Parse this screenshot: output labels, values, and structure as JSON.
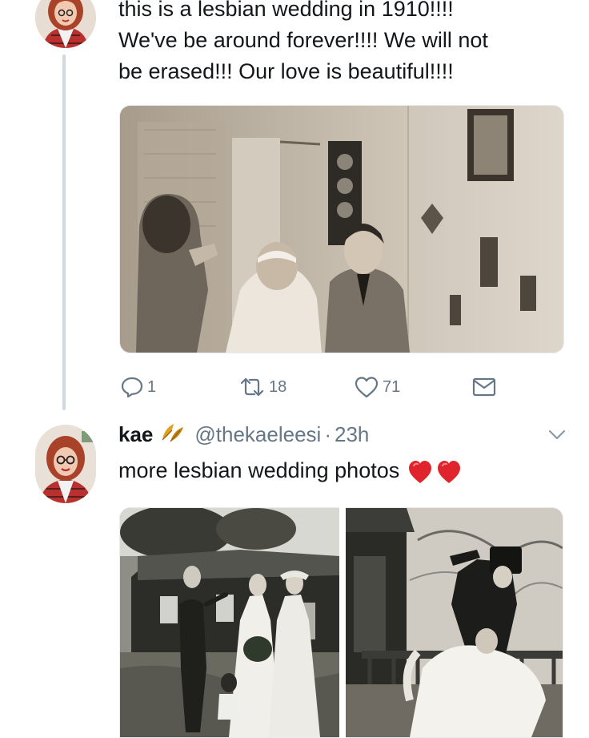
{
  "tweet1": {
    "text_line1": "this is a lesbian wedding in 1910!!!!",
    "text_line2": "We've be around forever!!!! We will not",
    "text_line3": "be erased!!! Our love is beautiful!!!!",
    "actions": {
      "reply_count": "1",
      "retweet_count": "18",
      "like_count": "71"
    }
  },
  "tweet2": {
    "display_name": "kae",
    "handle": "@thekaeleesi",
    "separator": "·",
    "time": "23h",
    "text": "more lesbian wedding photos"
  },
  "colors": {
    "thread_line": "#cfd9e2",
    "icon_gray": "#657786",
    "heart_red": "#e0242e",
    "text": "#14171a"
  },
  "icons": [
    "reply-icon",
    "retweet-icon",
    "like-icon",
    "message-icon",
    "chevron-down-icon",
    "leaf-emoji-icon",
    "heart-emoji-icon"
  ]
}
